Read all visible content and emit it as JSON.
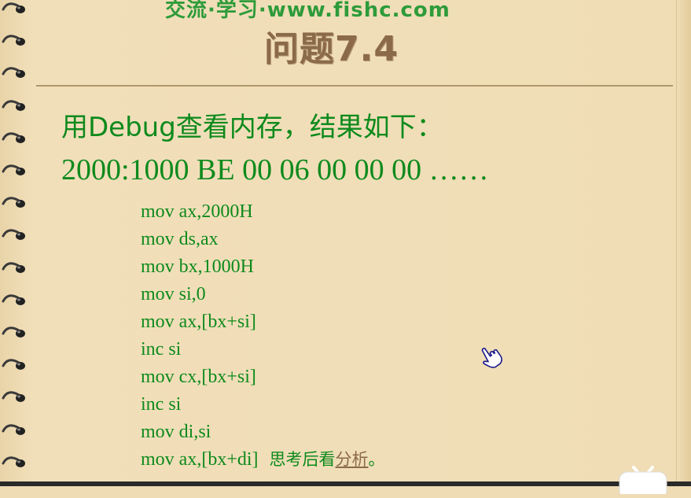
{
  "header": {
    "top_strip": "交流·学习·www.fishc.com",
    "title": "问题7.4"
  },
  "content": {
    "line1": "用Debug查看内存，结果如下：",
    "line2": "2000:1000 BE 00 06 00 00 00 ……",
    "code_lines": [
      "mov ax,2000H",
      "mov ds,ax",
      "mov bx,1000H",
      "mov si,0",
      "mov ax,[bx+si]",
      "inc si",
      "mov cx,[bx+si]",
      "inc si",
      "mov di,si",
      "mov ax,[bx+di]"
    ],
    "note_prefix": "思考后看",
    "note_link": "分析",
    "note_suffix": "。"
  },
  "colors": {
    "background": "#efdcb4",
    "text_green": "#0e8a1c",
    "title_brown": "#8b6a4a",
    "link_brown": "#8b6a4a"
  },
  "icons": {
    "binder_rings": "spiral-binding-rings",
    "cursor": "hand-pointer-icon",
    "watermark": "bilibili-tv-icon"
  }
}
